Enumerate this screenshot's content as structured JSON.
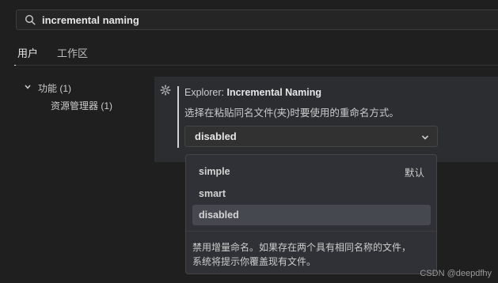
{
  "search": {
    "value": "incremental naming"
  },
  "tabs": [
    {
      "label": "用户",
      "active": true
    },
    {
      "label": "工作区",
      "active": false
    }
  ],
  "tree": {
    "group": "功能 (1)",
    "child": "资源管理器 (1)"
  },
  "setting": {
    "category": "Explorer: ",
    "name": "Incremental Naming",
    "description": "选择在粘贴同名文件(夹)时要使用的重命名方式。",
    "current_value": "disabled"
  },
  "dropdown": {
    "options": [
      {
        "label": "simple",
        "tag": "默认"
      },
      {
        "label": "smart",
        "tag": ""
      },
      {
        "label": "disabled",
        "tag": ""
      }
    ],
    "description_line1": "禁用增量命名。如果存在两个具有相同名称的文件，",
    "description_line2": "系统将提示你覆盖现有文件。"
  },
  "watermark": "CSDN @deepdfhy",
  "icons": {
    "search": "search-icon",
    "gear": "gear-icon",
    "chevron": "chevron-down-icon"
  }
}
